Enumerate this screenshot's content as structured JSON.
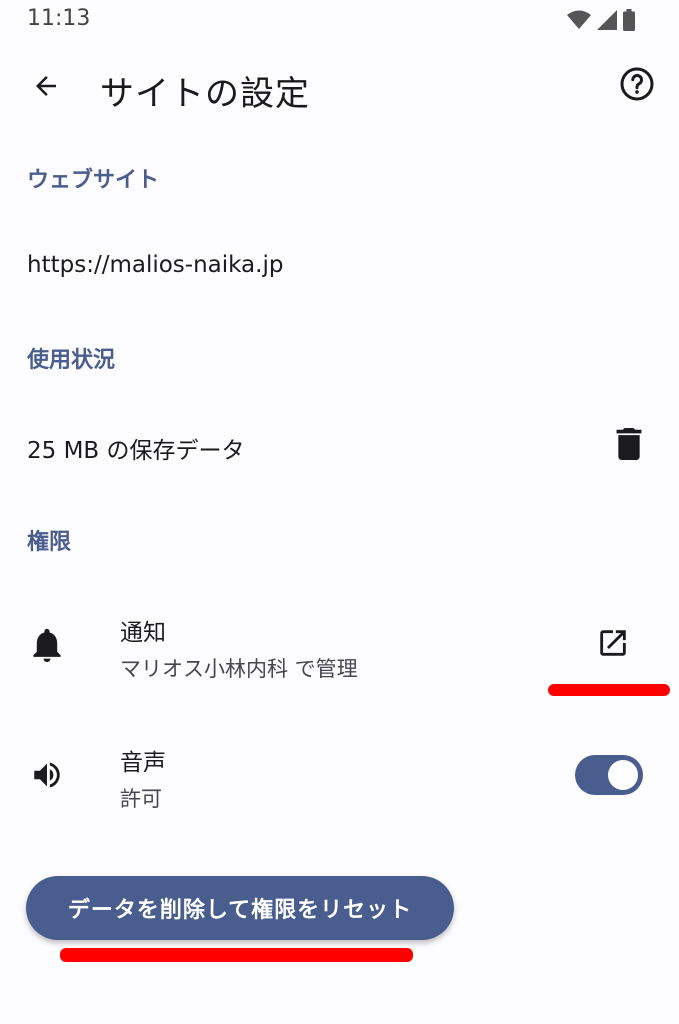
{
  "status_bar": {
    "time": "11:13"
  },
  "app_bar": {
    "title": "サイトの設定"
  },
  "website_section": {
    "header": "ウェブサイト",
    "url": "https://malios-naika.jp"
  },
  "usage_section": {
    "header": "使用状況",
    "storage": "25 MB の保存データ"
  },
  "permissions_section": {
    "header": "権限",
    "notifications": {
      "title": "通知",
      "subtitle": "マリオス小林内科 で管理"
    },
    "sound": {
      "title": "音声",
      "subtitle": "許可",
      "enabled": true
    }
  },
  "reset_button": {
    "label": "データを削除して権限をリセット"
  },
  "colors": {
    "accent": "#4a5d8f",
    "annotation": "#ff0000",
    "background": "#fdfcff"
  }
}
